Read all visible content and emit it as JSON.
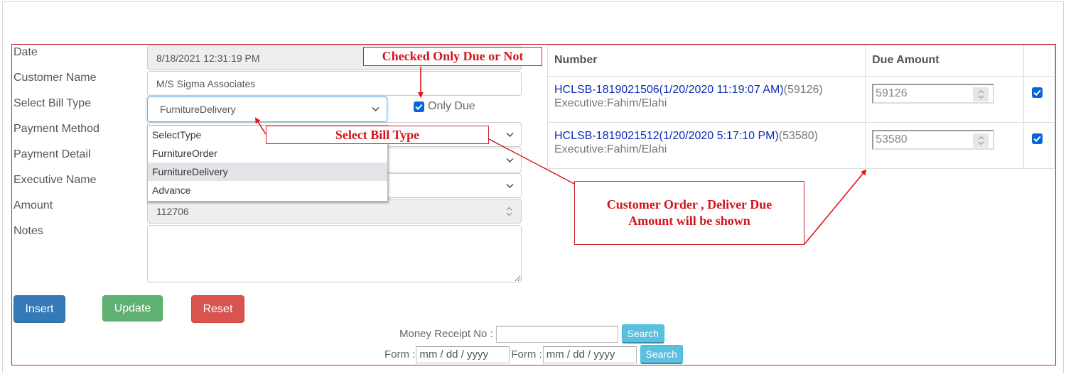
{
  "form": {
    "labels": {
      "date": "Date",
      "customer_name": "Customer Name",
      "bill_type": "Select Bill Type",
      "payment_method": "Payment Method",
      "payment_detail": "Payment Detail",
      "executive_name": "Executive Name",
      "amount": "Amount",
      "notes": "Notes"
    },
    "values": {
      "date": "8/18/2021 12:31:19 PM",
      "customer_name": "M/S Sigma Associates",
      "bill_type": "FurnitureDelivery",
      "payment_method": "",
      "payment_detail": "",
      "executive_name": "",
      "amount": "112706",
      "notes": ""
    },
    "bill_type_options": [
      "SelectType",
      "FurnitureOrder",
      "FurnitureDelivery",
      "Advance"
    ],
    "bill_type_highlighted_index": 2,
    "only_due": {
      "label": "Only Due",
      "checked": true
    }
  },
  "buttons": {
    "insert": "Insert",
    "update": "Update",
    "reset": "Reset"
  },
  "search": {
    "money_receipt_label": "Money Receipt No :",
    "money_receipt_value": "",
    "search_label": "Search",
    "form_label_1": "Form :",
    "form_label_2": "Form :",
    "date_placeholder_1": "mm / dd / yyyy",
    "date_placeholder_2": "mm / dd / yyyy"
  },
  "due_table": {
    "headers": [
      "Number",
      "Due Amount",
      ""
    ],
    "rows": [
      {
        "bill": "HCLSB-1819021506(1/20/2020 11:19:07 AM)",
        "bill_amount": "(59126)",
        "executive": "Executive:Fahim/Elahi",
        "due_amount": "59126",
        "checked": true
      },
      {
        "bill": "HCLSB-1819021512(1/20/2020 5:17:10 PM)",
        "bill_amount": "(53580)",
        "executive": "Executive:Fahim/Elahi",
        "due_amount": "53580",
        "checked": true
      }
    ]
  },
  "annotations": {
    "checked_only_due": "Checked Only Due or Not",
    "select_bill_type": "Select Bill Type",
    "customer_order_line1": "Customer Order , Deliver Due",
    "customer_order_line2": "Amount will be shown"
  },
  "colors": {
    "annotation_red": "#d2141b",
    "link_blue": "#0a2bb8",
    "insert_blue": "#337ab7",
    "update_green": "#5fb073",
    "reset_red": "#d9534f",
    "search_cyan": "#5bc0de",
    "checkbox_blue": "#0b63d8"
  }
}
